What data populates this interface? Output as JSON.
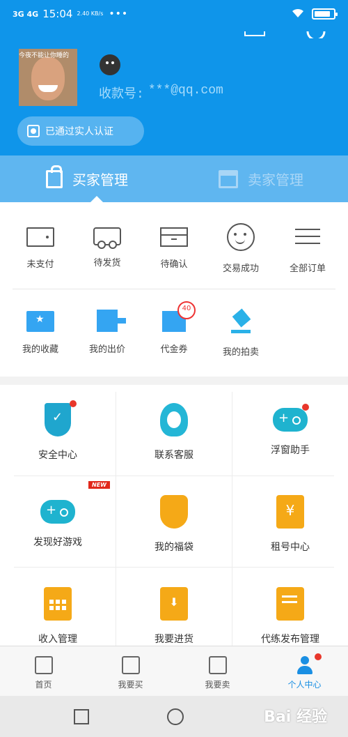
{
  "status_bar": {
    "signal": "3G 4G",
    "time": "15:04",
    "speed": "2.40 KB/s",
    "dots": "•••"
  },
  "header": {
    "avatar_overlay": "今夜不能让你睡的",
    "account_label": "收款号:",
    "account_value": "***@qq.com",
    "verify_label": "已通过实人认证"
  },
  "tabs": [
    {
      "label": "买家管理",
      "active": true
    },
    {
      "label": "卖家管理",
      "active": false
    }
  ],
  "orders": [
    {
      "label": "未支付",
      "icon": "wallet-icon"
    },
    {
      "label": "待发货",
      "icon": "truck-icon"
    },
    {
      "label": "待确认",
      "icon": "box-icon"
    },
    {
      "label": "交易成功",
      "icon": "smile-icon"
    },
    {
      "label": "全部订单",
      "icon": "list-icon"
    }
  ],
  "shortcuts": [
    {
      "label": "我的收藏",
      "icon": "favorite-folder-icon"
    },
    {
      "label": "我的出价",
      "icon": "bid-icon"
    },
    {
      "label": "代金券",
      "icon": "coupon-icon",
      "badge": "40"
    },
    {
      "label": "我的拍卖",
      "icon": "auction-icon"
    }
  ],
  "services": [
    {
      "label": "安全中心",
      "icon": "shield-icon",
      "dot": true
    },
    {
      "label": "联系客服",
      "icon": "customer-service-icon"
    },
    {
      "label": "浮窗助手",
      "icon": "gamepad-icon",
      "dot": true
    },
    {
      "label": "发现好游戏",
      "icon": "gamepad-icon",
      "badge": "NEW"
    },
    {
      "label": "我的福袋",
      "icon": "lucky-bag-icon"
    },
    {
      "label": "租号中心",
      "icon": "clipboard-yuan-icon"
    },
    {
      "label": "收入管理",
      "icon": "calculator-icon"
    },
    {
      "label": "我要进货",
      "icon": "shopping-bag-icon"
    },
    {
      "label": "代练发布管理",
      "icon": "note-icon"
    }
  ],
  "bottom_nav": [
    {
      "label": "首页",
      "icon": "home-icon"
    },
    {
      "label": "我要买",
      "icon": "shopping-bag-icon"
    },
    {
      "label": "我要卖",
      "icon": "store-icon"
    },
    {
      "label": "个人中心",
      "icon": "user-icon",
      "active": true
    }
  ],
  "watermark": "Bai 经验",
  "colors": {
    "primary": "#0f95ea",
    "tab_bar": "#5fb6f0",
    "accent_orange": "#f5a917",
    "alert_red": "#e8372b"
  }
}
